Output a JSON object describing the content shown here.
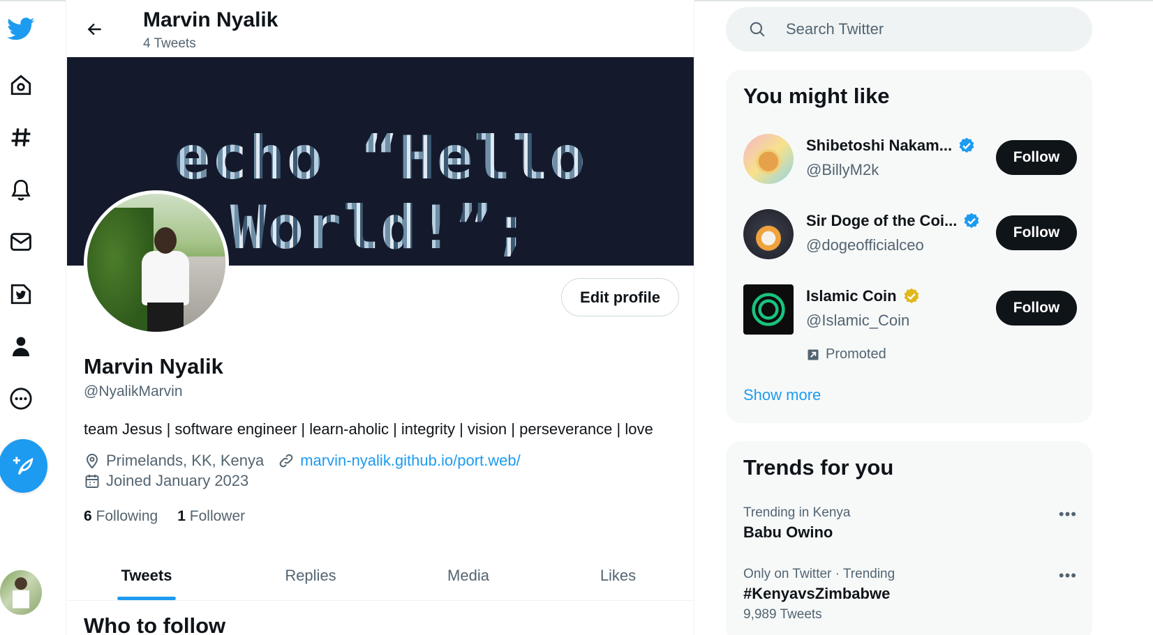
{
  "header": {
    "name": "Marvin Nyalik",
    "tweet_count": "4 Tweets"
  },
  "banner": {
    "text": "echo “Hello World!”;"
  },
  "profile": {
    "edit_label": "Edit profile",
    "name": "Marvin Nyalik",
    "handle": "@NyalikMarvin",
    "bio": "team Jesus | software engineer | learn-aholic | integrity | vision | perseverance | love",
    "location": "Primelands, KK, Kenya",
    "website": "marvin-nyalik.github.io/port.web/",
    "joined": "Joined January 2023",
    "following_count": "6",
    "following_label": "Following",
    "followers_count": "1",
    "followers_label": "Follower"
  },
  "tabs": [
    {
      "label": "Tweets"
    },
    {
      "label": "Replies"
    },
    {
      "label": "Media"
    },
    {
      "label": "Likes"
    }
  ],
  "who_to_follow_title": "Who to follow",
  "search": {
    "placeholder": "Search Twitter"
  },
  "suggestions": {
    "title": "You might like",
    "items": [
      {
        "name": "Shibetoshi Nakam...",
        "handle": "@BillyM2k",
        "follow": "Follow",
        "verified": "blue"
      },
      {
        "name": "Sir Doge of the Coi...",
        "handle": "@dogeofficialceo",
        "follow": "Follow",
        "verified": "blue"
      },
      {
        "name": "Islamic Coin",
        "handle": "@Islamic_Coin",
        "follow": "Follow",
        "verified": "gold",
        "promoted": "Promoted"
      }
    ],
    "show_more": "Show more"
  },
  "trends": {
    "title": "Trends for you",
    "items": [
      {
        "context": "Trending in Kenya",
        "title": "Babu Owino",
        "count": ""
      },
      {
        "context": "Only on Twitter · Trending",
        "title": "#KenyavsZimbabwe",
        "count": "9,989 Tweets"
      }
    ]
  },
  "colors": {
    "accent": "#1d9bf0",
    "text": "#0f1419",
    "muted": "#536471",
    "verified_gold": "#e2b719"
  },
  "icons": [
    "twitter-logo-icon",
    "home-icon",
    "explore-hashtag-icon",
    "notifications-bell-icon",
    "messages-mail-icon",
    "twitter-blue-icon",
    "profile-person-icon",
    "more-circle-icon",
    "compose-tweet-icon",
    "back-arrow-icon",
    "search-icon",
    "location-pin-icon",
    "link-icon",
    "calendar-icon",
    "verified-badge-icon",
    "promoted-icon",
    "more-dots-icon"
  ]
}
